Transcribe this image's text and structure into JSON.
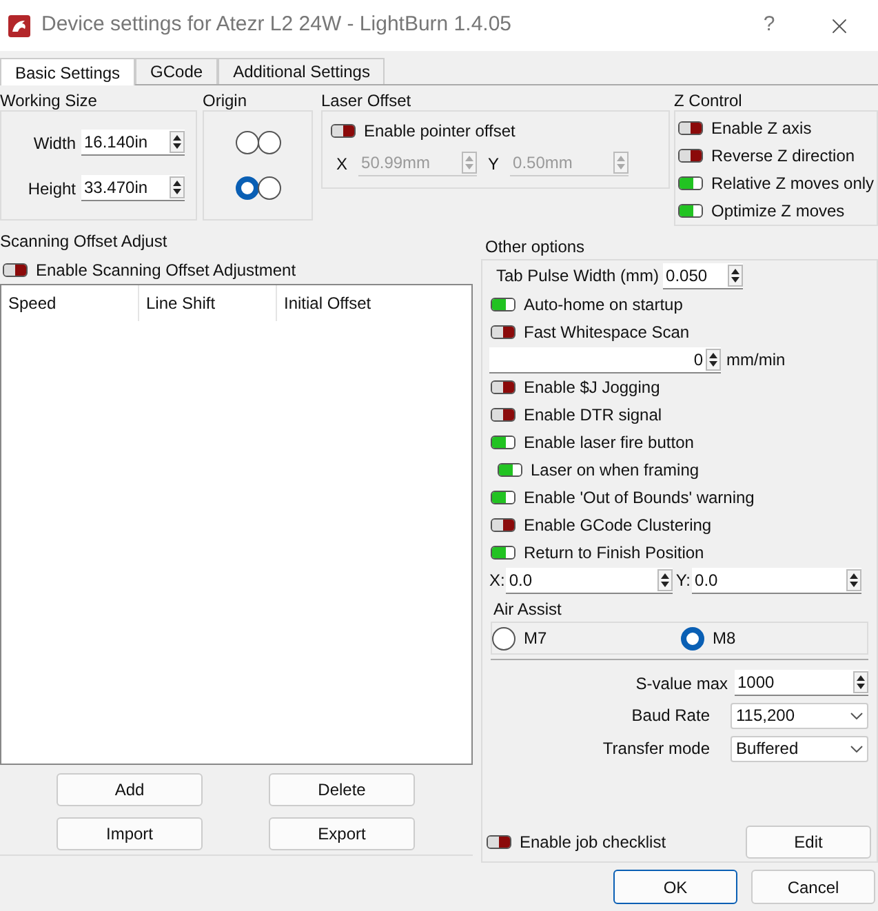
{
  "window": {
    "title": "Device settings for Atezr L2 24W - LightBurn 1.4.05",
    "help": "?"
  },
  "tabs": [
    {
      "label": "Basic Settings",
      "selected": true
    },
    {
      "label": "GCode",
      "selected": false
    },
    {
      "label": "Additional Settings",
      "selected": false
    }
  ],
  "working_size": {
    "title": "Working Size",
    "fields": [
      {
        "label": "Width",
        "value": "16.140in"
      },
      {
        "label": "Height",
        "value": "33.470in"
      }
    ]
  },
  "origin": {
    "title": "Origin",
    "options": [
      {
        "selected": false
      },
      {
        "selected": false
      },
      {
        "selected": true
      },
      {
        "selected": false
      }
    ]
  },
  "laser_offset": {
    "title": "Laser Offset",
    "toggle": {
      "label": "Enable pointer offset",
      "on": false
    },
    "fields": [
      {
        "label": "X",
        "value": "50.99mm",
        "disabled": true
      },
      {
        "label": "Y",
        "value": "0.50mm",
        "disabled": true
      }
    ]
  },
  "z_control": {
    "title": "Z Control",
    "toggles": [
      {
        "label": "Enable Z axis",
        "on": false
      },
      {
        "label": "Reverse Z direction",
        "on": false
      },
      {
        "label": "Relative Z moves only",
        "on": true
      },
      {
        "label": "Optimize Z moves",
        "on": true
      }
    ]
  },
  "scanning_offset": {
    "title": "Scanning Offset Adjust",
    "toggle": {
      "label": "Enable Scanning Offset Adjustment",
      "on": false
    },
    "table": {
      "columns": [
        "Speed",
        "Line Shift",
        "Initial Offset"
      ]
    },
    "buttons": [
      "Add",
      "Delete",
      "Import",
      "Export"
    ]
  },
  "other_options": {
    "title": "Other options",
    "tab_pulse_width": {
      "label": "Tab Pulse Width (mm)",
      "value": "0.050"
    },
    "items": [
      {
        "kind": "toggle",
        "label": "Auto-home on startup",
        "on": true
      },
      {
        "kind": "toggle",
        "label": "Fast Whitespace Scan",
        "on": false
      },
      {
        "kind": "speed",
        "value": "0",
        "unit": "mm/min"
      },
      {
        "kind": "toggle",
        "label": "Enable $J Jogging",
        "on": false
      },
      {
        "kind": "toggle",
        "label": "Enable DTR signal",
        "on": false
      },
      {
        "kind": "toggle",
        "label": "Enable laser fire button",
        "on": true,
        "children": [
          {
            "kind": "toggle",
            "label": "Laser on when framing",
            "on": true
          }
        ]
      },
      {
        "kind": "toggle",
        "label": "Enable 'Out of Bounds' warning",
        "on": true
      },
      {
        "kind": "toggle",
        "label": "Enable GCode Clustering",
        "on": false
      },
      {
        "kind": "toggle",
        "label": "Return to Finish Position",
        "on": true
      },
      {
        "kind": "xy",
        "fields": [
          {
            "label": "X:",
            "value": "0.0"
          },
          {
            "label": "Y:",
            "value": "0.0"
          }
        ]
      }
    ],
    "air_assist": {
      "title": "Air Assist",
      "options": [
        {
          "label": "M7",
          "selected": false
        },
        {
          "label": "M8",
          "selected": true
        }
      ]
    },
    "s_value_max": {
      "label": "S-value max",
      "value": "1000"
    },
    "baud_rate": {
      "label": "Baud Rate",
      "value": "115,200"
    },
    "transfer_mode": {
      "label": "Transfer mode",
      "value": "Buffered"
    },
    "job_checklist": {
      "label": "Enable job checklist",
      "on": false
    },
    "edit_button": "Edit"
  },
  "footer_buttons": [
    {
      "label": "OK",
      "default": true
    },
    {
      "label": "Cancel",
      "default": false
    }
  ]
}
